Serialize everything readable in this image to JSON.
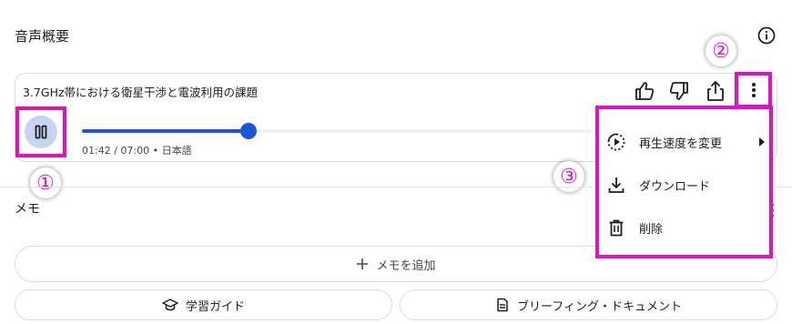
{
  "section": {
    "title": "音声概要"
  },
  "player": {
    "title": "3.7GHz帯における衛星干渉と電波利用の課題",
    "time_current": "01:42",
    "time_total": "07:00",
    "language": "日本語",
    "time_text": "01:42 / 07:00 • 日本語",
    "progress": 0.243
  },
  "callouts": {
    "one": "①",
    "two": "②",
    "three": "③"
  },
  "menu": {
    "items": [
      {
        "label": "再生速度を変更",
        "icon": "playback-speed-icon"
      },
      {
        "label": "ダウンロード",
        "icon": "download-icon"
      },
      {
        "label": "削除",
        "icon": "trash-icon"
      }
    ]
  },
  "memo": {
    "heading": "メモ",
    "add_label": "メモを追加",
    "study_guide": "学習ガイド",
    "briefing_doc": "ブリーフィング・ドキュメント"
  },
  "colors": {
    "accent": "#1a57d6",
    "highlight": "#e010c4",
    "pause_bg": "#c6d3f2"
  }
}
